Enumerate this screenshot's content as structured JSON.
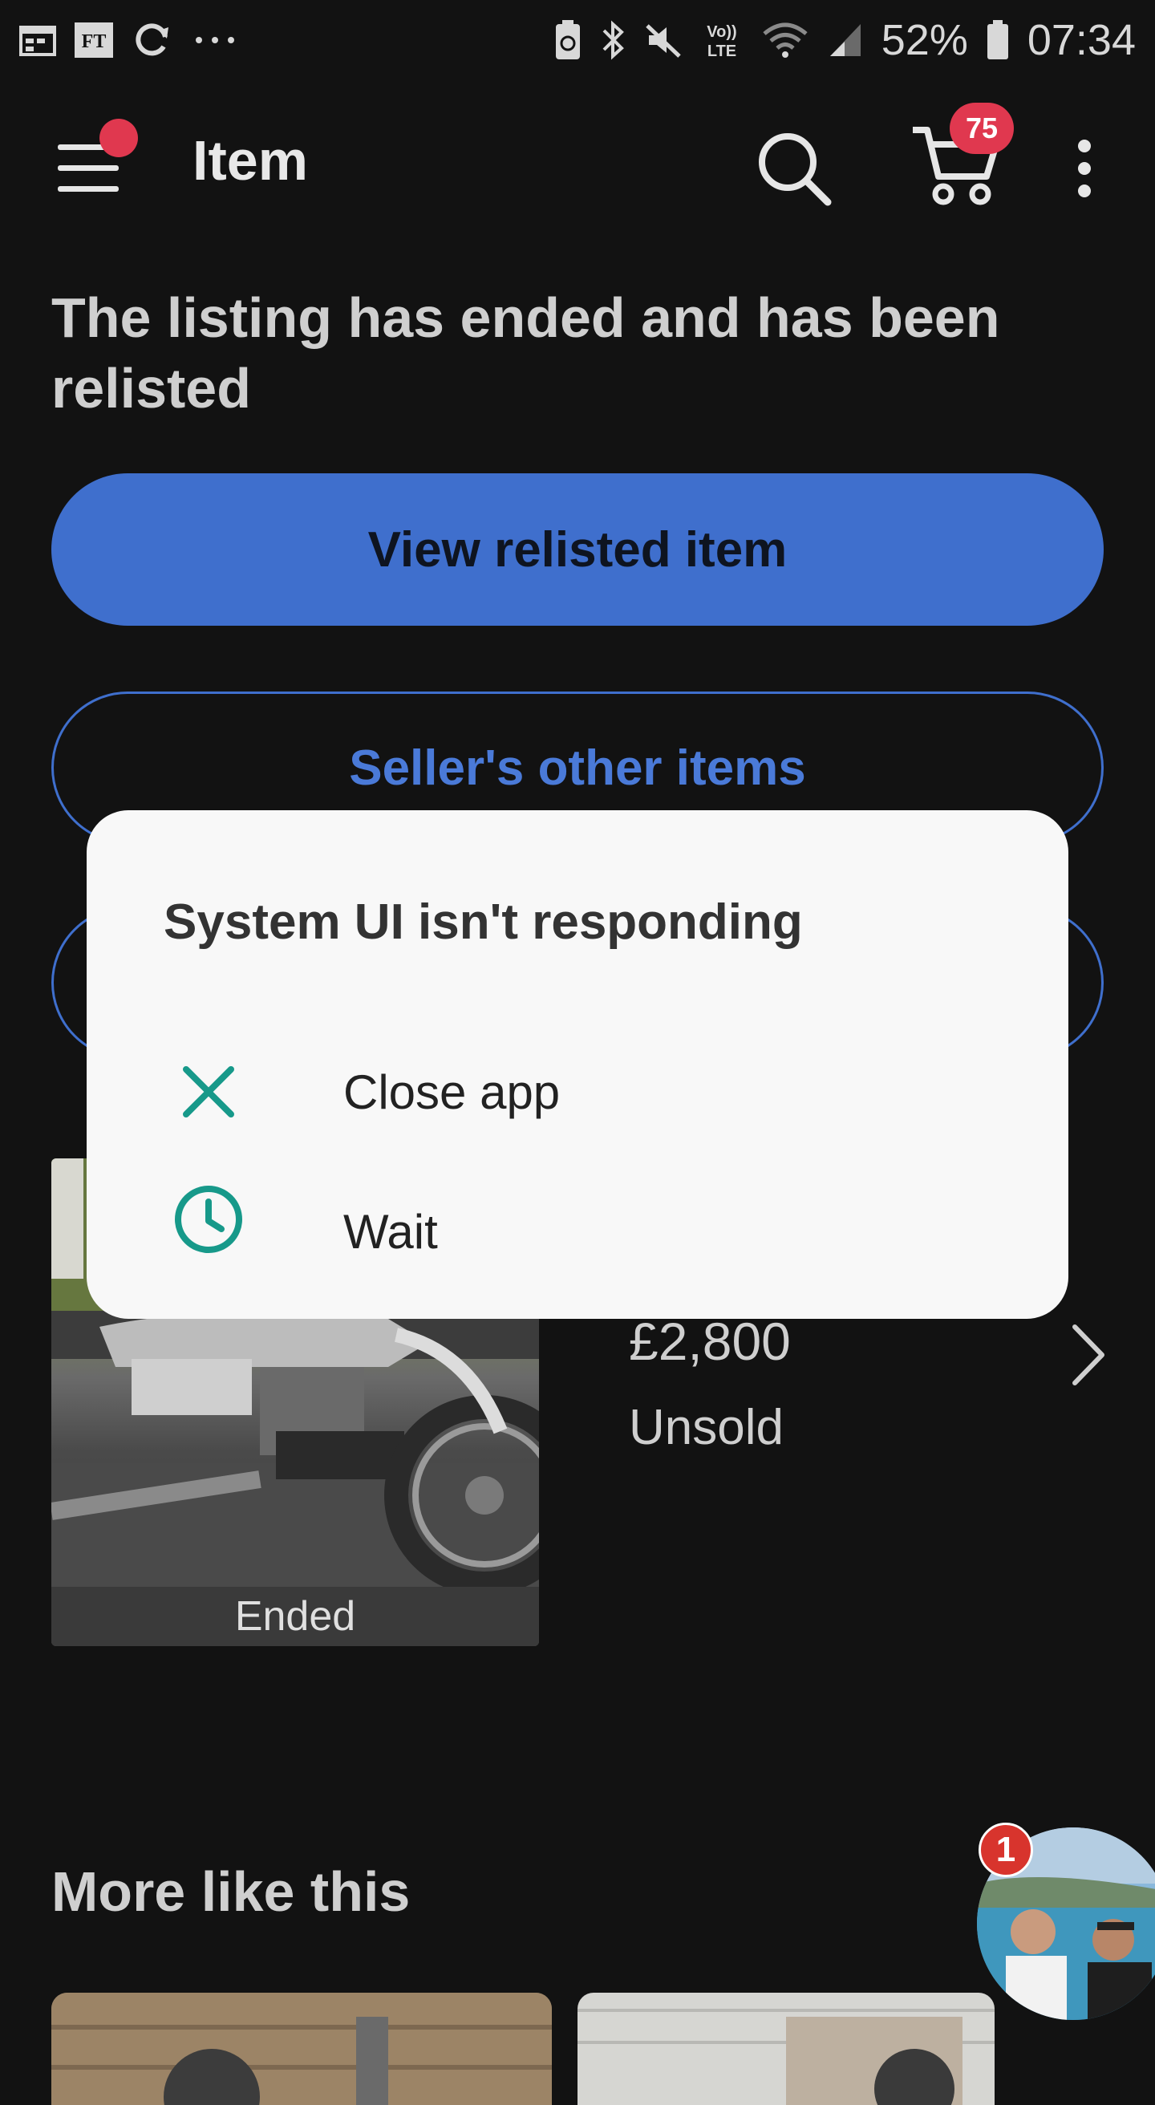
{
  "status_bar": {
    "battery_pct": "52%",
    "time": "07:34",
    "network_label": "LTE"
  },
  "app_bar": {
    "title": "Item",
    "cart_count": "75"
  },
  "listing": {
    "headline": "The listing has ended and has been relisted",
    "primary_button": "View relisted item",
    "secondary_button": "Seller's other items"
  },
  "item": {
    "price": "£2,800",
    "status": "Unsold",
    "photo_label": "Ended"
  },
  "section": {
    "more_like": "More like this"
  },
  "chat_head": {
    "badge": "1"
  },
  "dialog": {
    "title": "System UI isn't responding",
    "options": [
      {
        "label": "Close app",
        "icon": "close-icon"
      },
      {
        "label": "Wait",
        "icon": "clock-icon"
      }
    ]
  },
  "colors": {
    "accent": "#3f6fcd",
    "badge": "#e0384f",
    "dialog_icon": "#17998a",
    "background": "#121212"
  }
}
